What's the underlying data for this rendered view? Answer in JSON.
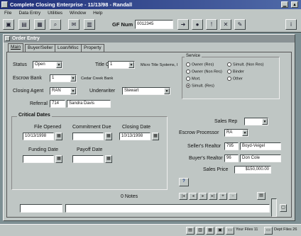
{
  "app": {
    "title": "Complete Closing Enterprise - 11/13/98 - Randall"
  },
  "menu": [
    "File",
    "Data Entry",
    "Utilities",
    "Window",
    "Help"
  ],
  "toolbar": {
    "gf_label": "GF Num",
    "gf_value": "0012345"
  },
  "order": {
    "window_title": "Order Entry",
    "tabs": [
      "Main",
      "Buyer/Seller",
      "Loan/Misc",
      "Property"
    ],
    "status_label": "Status",
    "status_value": "Open",
    "title_co_label": "Title Co",
    "title_co_value": "1",
    "title_co_name": "Micro Title Systems, I",
    "escrow_bank_label": "Escrow Bank",
    "escrow_bank_value": "1",
    "escrow_bank_name": "Cedar Creek Bank",
    "closing_agent_label": "Closing Agent",
    "closing_agent_value": "RAN",
    "underwriter_label": "Underwriter",
    "underwriter_value": "Stewart",
    "referral_label": "Referral",
    "referral_code": "714",
    "referral_name": "Sandra Davis",
    "service_label": "Service",
    "service_options": [
      "Owner (Res)",
      "Simult. (Non Res)",
      "Owner (Non Res)",
      "Binder",
      "Mort.",
      "Other",
      "Simult. (Res)"
    ],
    "critical_dates_label": "Critical Dates",
    "file_opened_label": "File Opened",
    "file_opened_value": "10/13/1998",
    "commitment_due_label": "Commitment Due",
    "commitment_due_value": "",
    "closing_date_label": "Closing Date",
    "closing_date_value": "10/13/1998",
    "funding_date_label": "Funding Date",
    "funding_date_value": "",
    "payoff_date_label": "Payoff Date",
    "payoff_date_value": "",
    "sales_rep_label": "Sales Rep",
    "sales_rep_value": "",
    "escrow_processor_label": "Escrow Processor",
    "escrow_processor_value": "RA",
    "sellers_realtor_label": "Seller's Realtor",
    "sellers_realtor_code": "795",
    "sellers_realtor_name": "Boyd-Veigel",
    "buyers_realtor_label": "Buyer's Realtor",
    "buyers_realtor_code": "96",
    "buyers_realtor_name": "Don Cole",
    "sales_price_label": "Sales Price",
    "sales_price_value": "$150,000.00",
    "help_button": "?",
    "notes_label": "0 Notes"
  },
  "statusbar": {
    "your_files": "Your Files 11",
    "dept_files": "Dept Files 26"
  },
  "colors": {
    "desktop": "#7d8f93",
    "face": "#bfc6c4",
    "title_bar": "#20307a",
    "inactive_title": "#8a9294"
  }
}
